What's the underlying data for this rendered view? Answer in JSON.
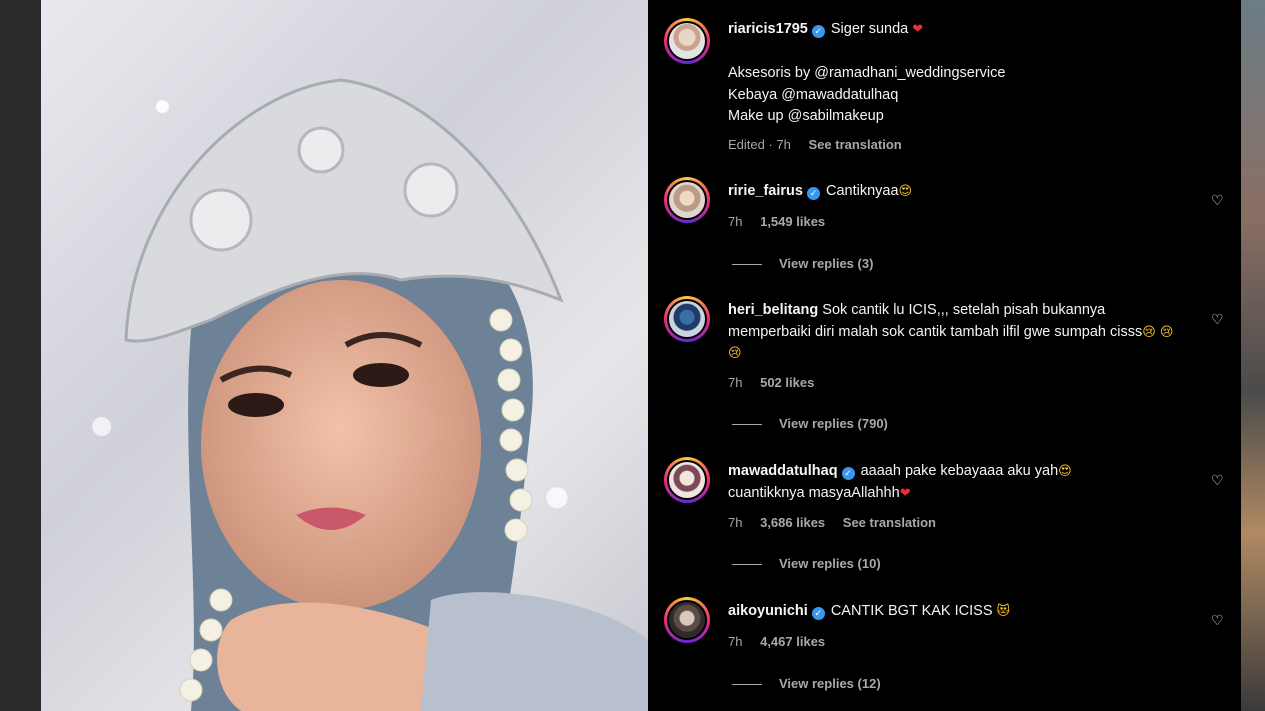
{
  "caption": {
    "username": "riaricis1795",
    "title_text": "Siger sunda",
    "title_emoji": "❤",
    "lines": [
      "Aksesoris by @ramadhani_weddingservice",
      "Kebaya @mawaddatulhaq",
      "Make up @sabilmakeup"
    ],
    "edited": "Edited · 7h",
    "see_translation": "See translation"
  },
  "comments": [
    {
      "username": "ririe_fairus",
      "verified": true,
      "text": "Cantiknyaa",
      "emoji": "😍",
      "time": "7h",
      "likes": "1,549 likes",
      "translation": "",
      "replies": "View replies (3)"
    },
    {
      "username": "heri_belitang",
      "verified": false,
      "text": "Sok cantik lu ICIS,,, setelah pisah bukannya memperbaiki diri malah sok cantik tambah ilfil gwe sumpah cisss",
      "emoji": "😢 😢 😢",
      "time": "7h",
      "likes": "502 likes",
      "translation": "",
      "replies": "View replies (790)"
    },
    {
      "username": "mawaddatulhaq",
      "verified": true,
      "text": "aaaah pake kebayaaa aku yah",
      "emoji": "😍",
      "text2": "cuantikknya masyaAllahhh",
      "emoji2": "❤",
      "time": "7h",
      "likes": "3,686 likes",
      "translation": "See translation",
      "replies": "View replies (10)"
    },
    {
      "username": "aikoyunichi",
      "verified": true,
      "text": "CANTIK BGT KAK ICISS",
      "emoji": "😻",
      "time": "7h",
      "likes": "4,467 likes",
      "translation": "",
      "replies": "View replies (12)"
    }
  ],
  "colors": {
    "panel_bg": "#000000",
    "text": "#f5f5f5",
    "secondary": "#a8a8a8",
    "verified": "#3897f0",
    "heart_red": "#ed2b3f"
  },
  "icons": {
    "verified": "verified-badge-icon",
    "like": "heart-outline-icon"
  }
}
